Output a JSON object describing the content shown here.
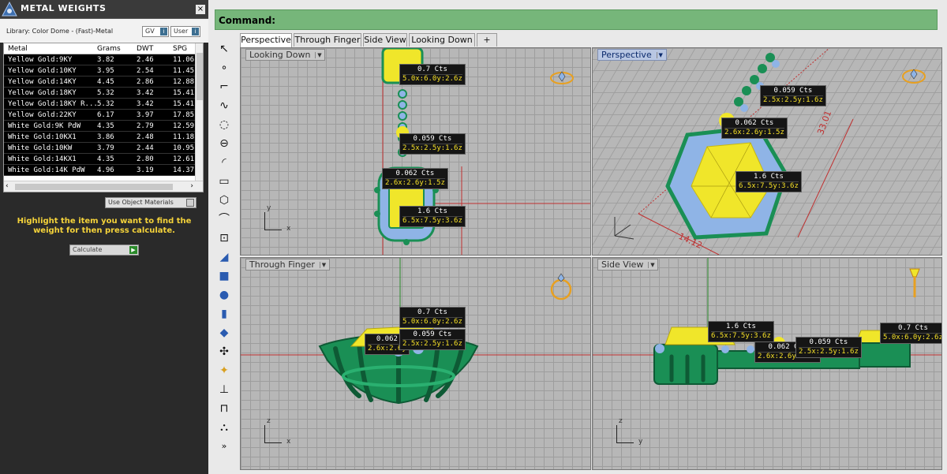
{
  "panel": {
    "title": "METAL WEIGHTS",
    "close": "×",
    "library_label": "Library: Color Dome - (Fast)-Metal",
    "btn_gv": "GV",
    "btn_user": "User",
    "table": {
      "headers": [
        "Metal",
        "Grams",
        "DWT",
        "SPG"
      ],
      "rows": [
        [
          "Yellow Gold:9KY",
          "3.82",
          "2.46",
          "11.06"
        ],
        [
          "Yellow Gold:10KY",
          "3.95",
          "2.54",
          "11.45"
        ],
        [
          "Yellow Gold:14KY",
          "4.45",
          "2.86",
          "12.88"
        ],
        [
          "Yellow Gold:18KY",
          "5.32",
          "3.42",
          "15.41"
        ],
        [
          "Yellow Gold:18KY R...",
          "5.32",
          "3.42",
          "15.41"
        ],
        [
          "Yellow Gold:22KY",
          "6.17",
          "3.97",
          "17.85"
        ],
        [
          "White Gold:9K PdW",
          "4.35",
          "2.79",
          "12.59"
        ],
        [
          "White Gold:10KX1",
          "3.86",
          "2.48",
          "11.18"
        ],
        [
          "White Gold:10KW",
          "3.79",
          "2.44",
          "10.95"
        ],
        [
          "White Gold:14KX1",
          "4.35",
          "2.80",
          "12.61"
        ],
        [
          "White Gold:14K PdW",
          "4.96",
          "3.19",
          "14.37"
        ]
      ]
    },
    "use_object_materials": "Use Object Materials",
    "hint": "Highlight the item you want to find the weight for then press calculate.",
    "calculate": "Calculate"
  },
  "command_label": "Command:",
  "tabs": [
    "Perspective",
    "Through Finger",
    "Side View",
    "Looking Down",
    "+"
  ],
  "viewports": {
    "looking_down": {
      "label": "Looking Down",
      "tags": [
        {
          "cts": "0.7 Cts",
          "dims": "5.0x:6.0y:2.6z"
        },
        {
          "cts": "0.059 Cts",
          "dims": "2.5x:2.5y:1.6z"
        },
        {
          "cts": "0.062 Cts",
          "dims": "2.6x:2.6y:1.5z"
        },
        {
          "cts": "1.6 Cts",
          "dims": "6.5x:7.5y:3.6z"
        }
      ],
      "axes": {
        "y": "y",
        "x": "x"
      }
    },
    "perspective": {
      "label": "Perspective",
      "tags": [
        {
          "cts": "0.059 Cts",
          "dims": "2.5x:2.5y:1.6z"
        },
        {
          "cts": "0.062 Cts",
          "dims": "2.6x:2.6y:1.5z"
        },
        {
          "cts": "1.6 Cts",
          "dims": "6.5x:7.5y:3.6z"
        }
      ],
      "dim1": "33.01",
      "dim2": "14.12"
    },
    "through_finger": {
      "label": "Through Finger",
      "tags": [
        {
          "cts": "0.7 Cts",
          "dims": "5.0x:6.0y:2.6z"
        },
        {
          "cts": "0.062",
          "dims": "2.6x:2.6y"
        },
        {
          "cts": "0.059 Cts",
          "dims": "2.5x:2.5y:1.6z"
        }
      ],
      "axes": {
        "z": "z",
        "x": "x"
      }
    },
    "side_view": {
      "label": "Side View",
      "tags": [
        {
          "cts": "1.6 Cts",
          "dims": "6.5x:7.5y:3.6z"
        },
        {
          "cts": "0.062 Cts",
          "dims": "2.6x:2.6y:1.5z"
        },
        {
          "cts": "0.059 Cts",
          "dims": "2.5x:2.5y:1.6z"
        },
        {
          "cts": "0.7 Cts",
          "dims": "5.0x:6.0y:2.6z"
        }
      ],
      "axes": {
        "z": "z",
        "y": "y"
      }
    }
  },
  "colors": {
    "gold": "#f0e62a",
    "prong_green": "#1a8f55",
    "stone_blue": "#8fb4e6",
    "command_bar": "#76b67a",
    "hint_text": "#f5d33a"
  }
}
